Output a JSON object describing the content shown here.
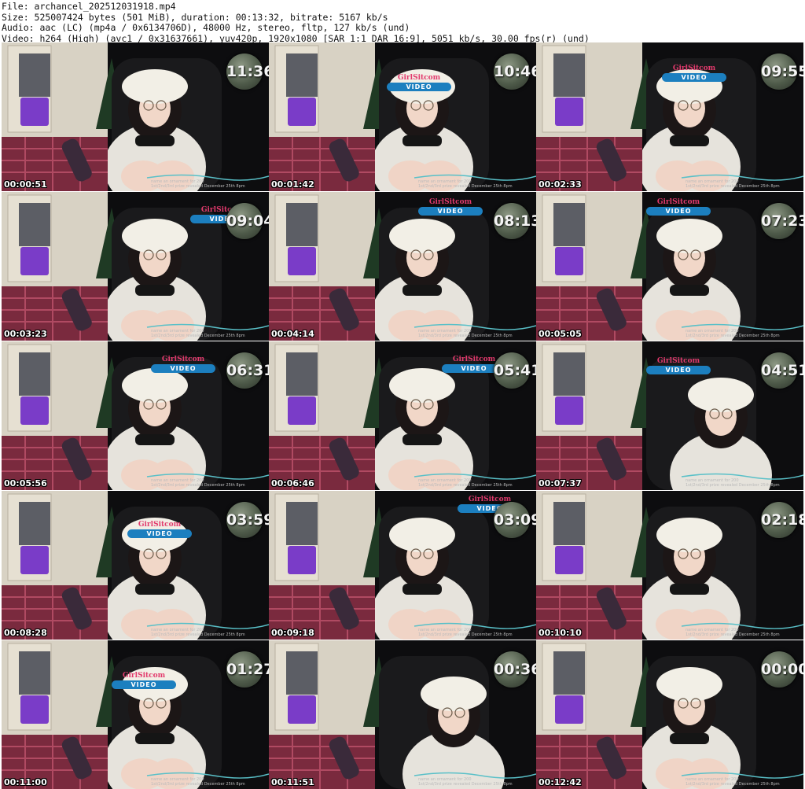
{
  "header": {
    "line1": "File: archancel_202512031918.mp4",
    "line2": "Size: 525007424 bytes (501 MiB), duration: 00:13:32, bitrate: 5167 kb/s",
    "line3": "Audio: aac (LC) (mp4a / 0x6134706D), 48000 Hz, stereo, fltp, 127 kb/s (und)",
    "line4": "Video: h264 (High) (avc1 / 0x31637661), yuv420p, 1920x1080 [SAR 1:1 DAR 16:9], 5051 kb/s, 30.00 fps(r) (und)"
  },
  "overlay": {
    "tagline1": "name an ornament for 200",
    "tagline2": "1st/2nd/3rd prize revealed December 25th 8pm"
  },
  "thumbnails": [
    {
      "timestamp": "00:00:51",
      "clock": "11:36",
      "badge_visible": false
    },
    {
      "timestamp": "00:01:42",
      "clock": "10:46",
      "badge_visible": true
    },
    {
      "timestamp": "00:02:33",
      "clock": "09:55",
      "badge_visible": true
    },
    {
      "timestamp": "00:03:23",
      "clock": "09:04",
      "badge_visible": true
    },
    {
      "timestamp": "00:04:14",
      "clock": "08:13",
      "badge_visible": true
    },
    {
      "timestamp": "00:05:05",
      "clock": "07:23",
      "badge_visible": true
    },
    {
      "timestamp": "00:05:56",
      "clock": "06:31",
      "badge_visible": true
    },
    {
      "timestamp": "00:06:46",
      "clock": "05:41",
      "badge_visible": true
    },
    {
      "timestamp": "00:07:37",
      "clock": "04:51",
      "badge_visible": true
    },
    {
      "timestamp": "00:08:28",
      "clock": "03:59",
      "badge_visible": true
    },
    {
      "timestamp": "00:09:18",
      "clock": "03:09",
      "badge_visible": true
    },
    {
      "timestamp": "00:10:10",
      "clock": "02:18",
      "badge_visible": false
    },
    {
      "timestamp": "00:11:00",
      "clock": "01:27",
      "badge_visible": true
    },
    {
      "timestamp": "00:11:51",
      "clock": "00:36",
      "badge_visible": false
    },
    {
      "timestamp": "00:12:42",
      "clock": "00:00",
      "badge_visible": false
    }
  ],
  "badge": {
    "text1": "GirlSitcom",
    "text2": "VIDEO"
  },
  "colors": {
    "background": "#0d0d0f",
    "wall": "#d8d2c4",
    "sweater": "#e6e3dc",
    "hat": "#f2efe6",
    "hair": "#1c1616",
    "skirt": "#7a2a3e",
    "badge_pill": "#1c7fbf",
    "badge_text": "#e23a6d"
  }
}
